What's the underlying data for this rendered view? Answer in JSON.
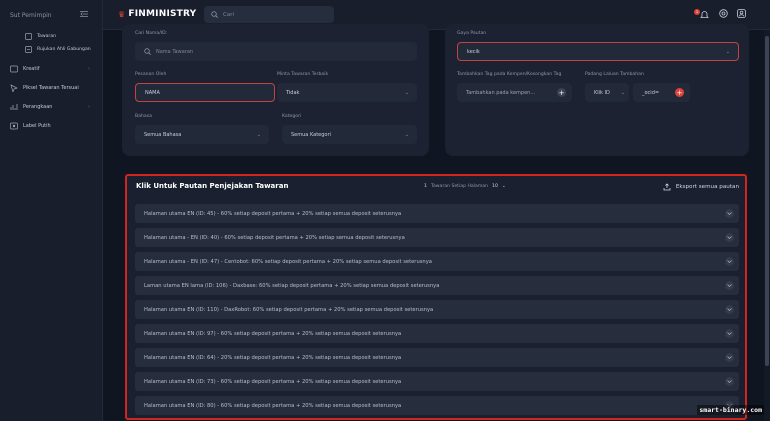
{
  "sidebar": {
    "header": "Sut Pemimpin",
    "items": [
      {
        "label": "Tawaran",
        "icon": "offer-icon"
      },
      {
        "label": "Rujukan Ahli Gabungan",
        "icon": "referral-icon"
      },
      {
        "label": "Kreatif",
        "icon": "creative-icon"
      },
      {
        "label": "Piksel Tawaran Tersuai",
        "icon": "pixel-icon"
      },
      {
        "label": "Perangkaan",
        "icon": "stats-icon"
      },
      {
        "label": "Label Putih",
        "icon": "white-label-icon"
      }
    ]
  },
  "topbar": {
    "brand": "FINMINISTRY",
    "search_placeholder": "Cari",
    "notif_count": "1"
  },
  "filters": {
    "search_label": "Cari Nama/ID:",
    "search_placeholder": "Nama Tawaran",
    "offer_by_label": "Pesanan Oleh",
    "offer_by_value": "NAMA",
    "interest_label": "Minta Tawaran Terbaik",
    "interest_value": "Tidak",
    "language_label": "Bahasa",
    "language_value": "Semua Bahasa",
    "category_label": "Kategori",
    "category_value": "Semua Kategori"
  },
  "link_settings": {
    "style_label": "Gaya Pautan",
    "style_value": "kecik",
    "tags_label": "Tambahkan Tag pada Kempen/Kosongkan Tag",
    "tags_placeholder": "Tambahkan pada kempen...",
    "param_label": "Padang Laluan Tambahan",
    "param_type": "Klik ID",
    "param_value": "_ocid="
  },
  "links_panel": {
    "title": "Klik Untuk Pautan Penjejakan Tawaran",
    "page_num": "1",
    "per_page_label": "Tawaran Setiap Halaman",
    "per_page_value": "10",
    "export_label": "Eksport semua pautan",
    "rows": [
      "Halaman utama EN (ID: 45) - 60% setiap deposit pertama + 20% setiap semua deposit seterusnya",
      "Halaman utama - EN (ID: 40) - 60% setiap deposit pertama + 20% setiap semua deposit seterusnya",
      "Halaman utama - EN (ID: 47) - Centobot: 60% setiap deposit pertama + 20% setiap semua deposit seterusnya",
      "Laman utama EN lama (ID: 106) - Daxbase: 60% setiap deposit pertama + 20% setiap semua deposit seterusnya",
      "Halaman utama EN (ID: 110) - DaxRobot: 60% setiap deposit pertama + 20% setiap semua deposit seterusnya",
      "Halaman utama EN (ID: 97) - 60% setiap deposit pertama + 20% setiap semua deposit seterusnya",
      "Halaman utama EN (ID: 64) - 20% setiap deposit pertama + 20% setiap semua deposit seterusnya",
      "Halaman utama EN (ID: 73) - 60% setiap deposit pertama + 20% setiap semua deposit seterusnya",
      "Halaman utama EN (ID: 80) - 60% setiap deposit pertama + 20% setiap semua deposit seterusnya"
    ]
  },
  "watermark": "smart-binary.com",
  "colors": {
    "accent": "#e0423a",
    "highlight_border": "#d0261e",
    "background": "#101522"
  }
}
